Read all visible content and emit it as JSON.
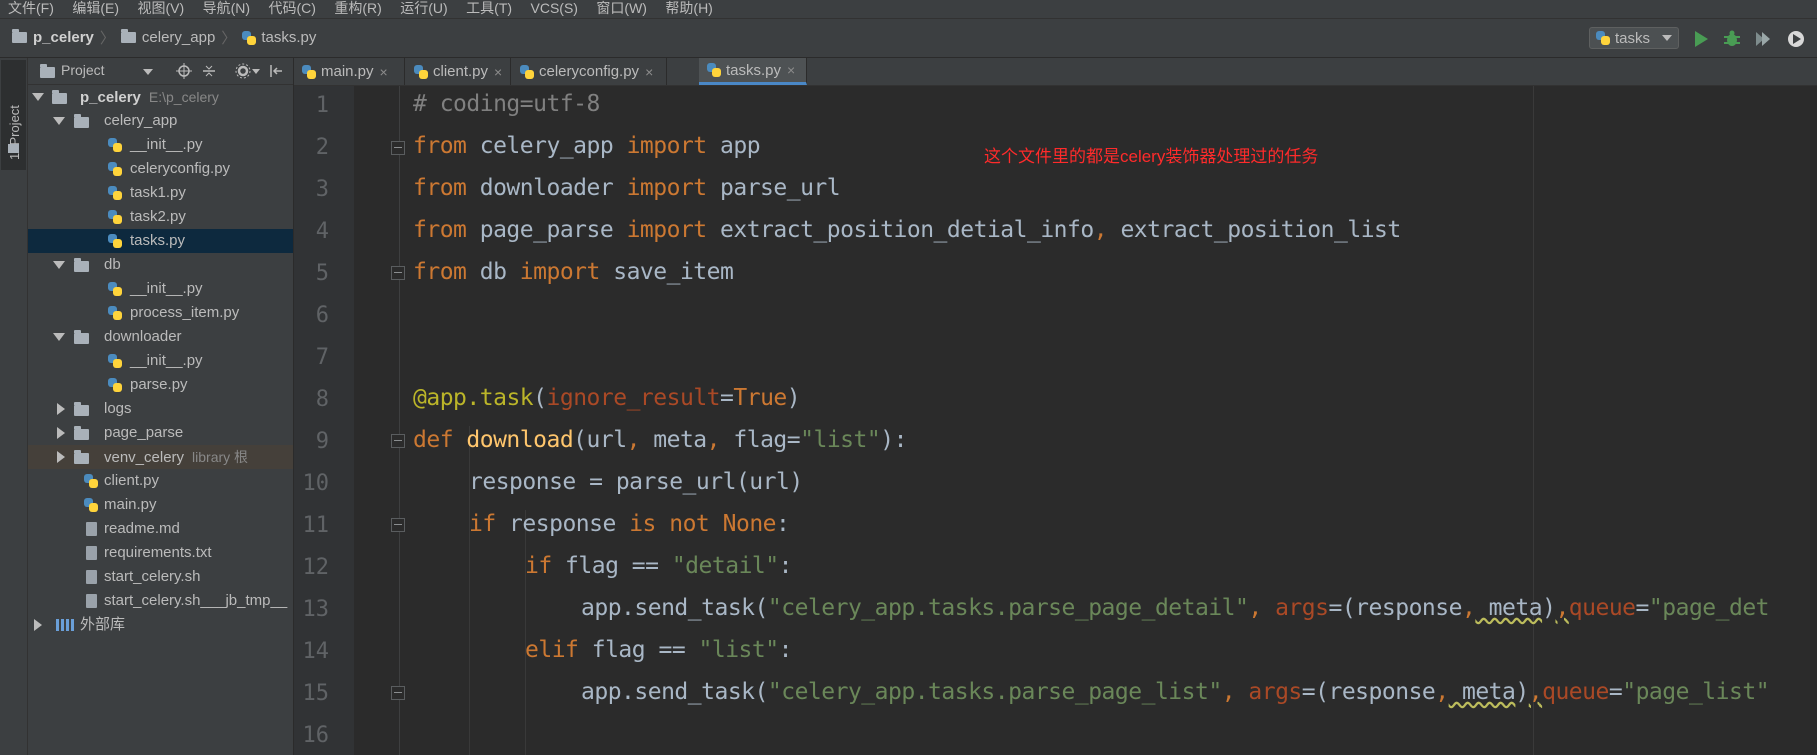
{
  "menu": [
    "文件(F)",
    "编辑(E)",
    "视图(V)",
    "导航(N)",
    "代码(C)",
    "重构(R)",
    "运行(U)",
    "工具(T)",
    "VCS(S)",
    "窗口(W)",
    "帮助(H)"
  ],
  "breadcrumb": {
    "project": "p_celery",
    "folder": "celery_app",
    "file": "tasks.py"
  },
  "run_config": {
    "selected": "tasks"
  },
  "tool_window": {
    "label": "1: Project"
  },
  "project_panel": {
    "title": "Project",
    "tree": [
      {
        "label": "p_celery",
        "extra": "E:\\p_celery",
        "type": "folder",
        "expanded": true
      },
      {
        "label": "celery_app",
        "type": "folder",
        "expanded": true
      },
      {
        "label": "__init__.py",
        "type": "py"
      },
      {
        "label": "celeryconfig.py",
        "type": "py"
      },
      {
        "label": "task1.py",
        "type": "py"
      },
      {
        "label": "task2.py",
        "type": "py"
      },
      {
        "label": "tasks.py",
        "type": "py",
        "selected": true
      },
      {
        "label": "db",
        "type": "folder",
        "expanded": true
      },
      {
        "label": "__init__.py",
        "type": "py"
      },
      {
        "label": "process_item.py",
        "type": "py"
      },
      {
        "label": "downloader",
        "type": "folder",
        "expanded": true
      },
      {
        "label": "__init__.py",
        "type": "py"
      },
      {
        "label": "parse.py",
        "type": "py"
      },
      {
        "label": "logs",
        "type": "folder",
        "expanded": false
      },
      {
        "label": "page_parse",
        "type": "folder",
        "expanded": false
      },
      {
        "label": "venv_celery",
        "extra": "library 根",
        "type": "folder",
        "expanded": false
      },
      {
        "label": "client.py",
        "type": "py"
      },
      {
        "label": "main.py",
        "type": "py"
      },
      {
        "label": "readme.md",
        "type": "file"
      },
      {
        "label": "requirements.txt",
        "type": "file"
      },
      {
        "label": "start_celery.sh",
        "type": "file"
      },
      {
        "label": "start_celery.sh___jb_tmp__",
        "type": "file"
      },
      {
        "label": "外部库",
        "type": "lib",
        "expanded": false
      }
    ]
  },
  "tabs": [
    {
      "label": "main.py",
      "close": "×"
    },
    {
      "label": "client.py",
      "close": "×"
    },
    {
      "label": "celeryconfig.py",
      "close": "×"
    },
    {
      "label": "tasks.py",
      "close": "×",
      "active": true
    }
  ],
  "editor": {
    "line_numbers": [
      "1",
      "2",
      "3",
      "4",
      "5",
      "6",
      "7",
      "8",
      "9",
      "10",
      "11",
      "12",
      "13",
      "14",
      "15",
      "16"
    ],
    "annotation": "这个文件里的都是celery装饰器处理过的任务",
    "code": {
      "l1_comment": "# coding=utf-8",
      "l2": {
        "from": "from",
        "mod": " celery_app ",
        "imp": "import",
        "name": " app"
      },
      "l3": {
        "from": "from",
        "mod": " downloader ",
        "imp": "import",
        "name": " parse_url"
      },
      "l4": {
        "from": "from",
        "mod": " page_parse ",
        "imp": "import",
        "name1": " extract_position_detial_info",
        "comma": ",",
        "name2": " extract_position_list"
      },
      "l5": {
        "from": "from",
        "mod": " db ",
        "imp": "import",
        "name": " save_item"
      },
      "l8": {
        "dec": "@app.",
        "task": "task",
        "open": "(",
        "param": "ignore_result",
        "eq": "=",
        "val": "True",
        "close": ")"
      },
      "l9": {
        "def": "def",
        "fn": " download",
        "a": "(url",
        "c1": ",",
        "b": " meta",
        "c2": ",",
        "c": " flag=",
        "str": "\"list\"",
        "end": "):"
      },
      "l10": "response = parse_url(url)",
      "l11": {
        "if": "if",
        "mid": " response ",
        "is": "is not",
        "none": " None",
        "colon": ":"
      },
      "l12": {
        "if": "if",
        "mid": " flag == ",
        "str": "\"detail\"",
        "colon": ":"
      },
      "l13": {
        "call": "app.send_task(",
        "str": "\"celery_app.tasks.parse_page_detail\"",
        "c1": ",",
        "args": " args",
        "eq": "=(response",
        "c2": ",",
        "meta": " meta",
        "rp": ")",
        "c3": ",",
        "queue": "queue",
        "eq2": "=",
        "qstr": "\"page_det"
      },
      "l14": {
        "elif": "elif",
        "mid": " flag == ",
        "str": "\"list\"",
        "colon": ":"
      },
      "l15": {
        "call": "app.send_task(",
        "str": "\"celery_app.tasks.parse_page_list\"",
        "c1": ",",
        "args": " args",
        "eq": "=(response",
        "c2": ",",
        "meta": " meta",
        "rp": ")",
        "c3": ",",
        "queue": "queue",
        "eq2": "=",
        "qstr": "\"page_list\""
      }
    }
  }
}
